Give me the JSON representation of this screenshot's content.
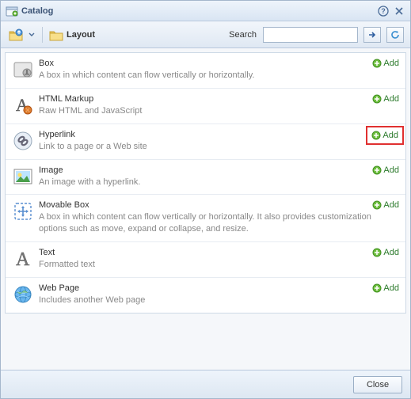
{
  "dialog": {
    "title": "Catalog",
    "help_tooltip": "Help",
    "close_tooltip": "Close"
  },
  "toolbar": {
    "up_tooltip": "Up",
    "breadcrumb": {
      "folder": "Layout"
    },
    "search_label": "Search",
    "search_value": "",
    "go_tooltip": "Go",
    "refresh_tooltip": "Refresh"
  },
  "add_label": "Add",
  "items": [
    {
      "title": "Box",
      "desc": "A box in which content can flow vertically or horizontally.",
      "highlight": false
    },
    {
      "title": "HTML Markup",
      "desc": "Raw HTML and JavaScript",
      "highlight": false
    },
    {
      "title": "Hyperlink",
      "desc": "Link to a page or a Web site",
      "highlight": true
    },
    {
      "title": "Image",
      "desc": "An image with a hyperlink.",
      "highlight": false
    },
    {
      "title": "Movable Box",
      "desc": "A box in which content can flow vertically or horizontally. It also provides customization options such as move, expand or collapse, and resize.",
      "highlight": false
    },
    {
      "title": "Text",
      "desc": "Formatted text",
      "highlight": false
    },
    {
      "title": "Web Page",
      "desc": "Includes another Web page",
      "highlight": false
    }
  ],
  "footer": {
    "close": "Close"
  }
}
